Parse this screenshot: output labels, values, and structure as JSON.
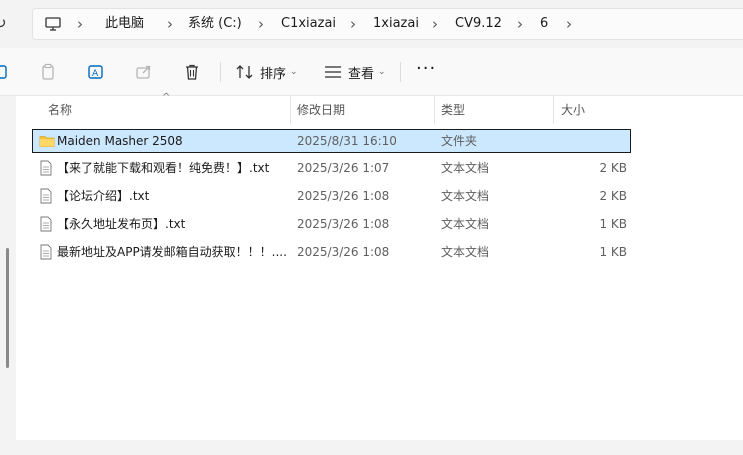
{
  "address": {
    "crumbs": [
      "此电脑",
      "系统 (C:)",
      "C1xiazai",
      "1xiazai",
      "CV9.12",
      "6"
    ]
  },
  "toolbar": {
    "sort_label": "排序",
    "view_label": "查看",
    "icons": [
      "scissors-icon",
      "copy-icon",
      "paste-icon",
      "rename-icon",
      "share-icon",
      "delete-icon",
      "sort-icon",
      "view-icon",
      "more-icon"
    ]
  },
  "columns": {
    "name": "名称",
    "modified": "修改日期",
    "type": "类型",
    "size": "大小"
  },
  "files": [
    {
      "name": "Maiden Masher 2508",
      "modified": "2025/8/31 16:10",
      "type": "文件夹",
      "size": "",
      "icon": "folder-icon",
      "selected": true
    },
    {
      "name": "【来了就能下载和观看！纯免费！】.txt",
      "modified": "2025/3/26 1:07",
      "type": "文本文档",
      "size": "2 KB",
      "icon": "text-file-icon",
      "selected": false
    },
    {
      "name": "【论坛介绍】.txt",
      "modified": "2025/3/26 1:08",
      "type": "文本文档",
      "size": "2 KB",
      "icon": "text-file-icon",
      "selected": false
    },
    {
      "name": "【永久地址发布页】.txt",
      "modified": "2025/3/26 1:08",
      "type": "文本文档",
      "size": "1 KB",
      "icon": "text-file-icon",
      "selected": false
    },
    {
      "name": "最新地址及APP请发邮箱自动获取！！！....",
      "modified": "2025/3/26 1:08",
      "type": "文本文档",
      "size": "1 KB",
      "icon": "text-file-icon",
      "selected": false
    }
  ],
  "colors": {
    "selection": "#cce8ff",
    "folder": "#f4c542",
    "accent": "#0067c0"
  }
}
